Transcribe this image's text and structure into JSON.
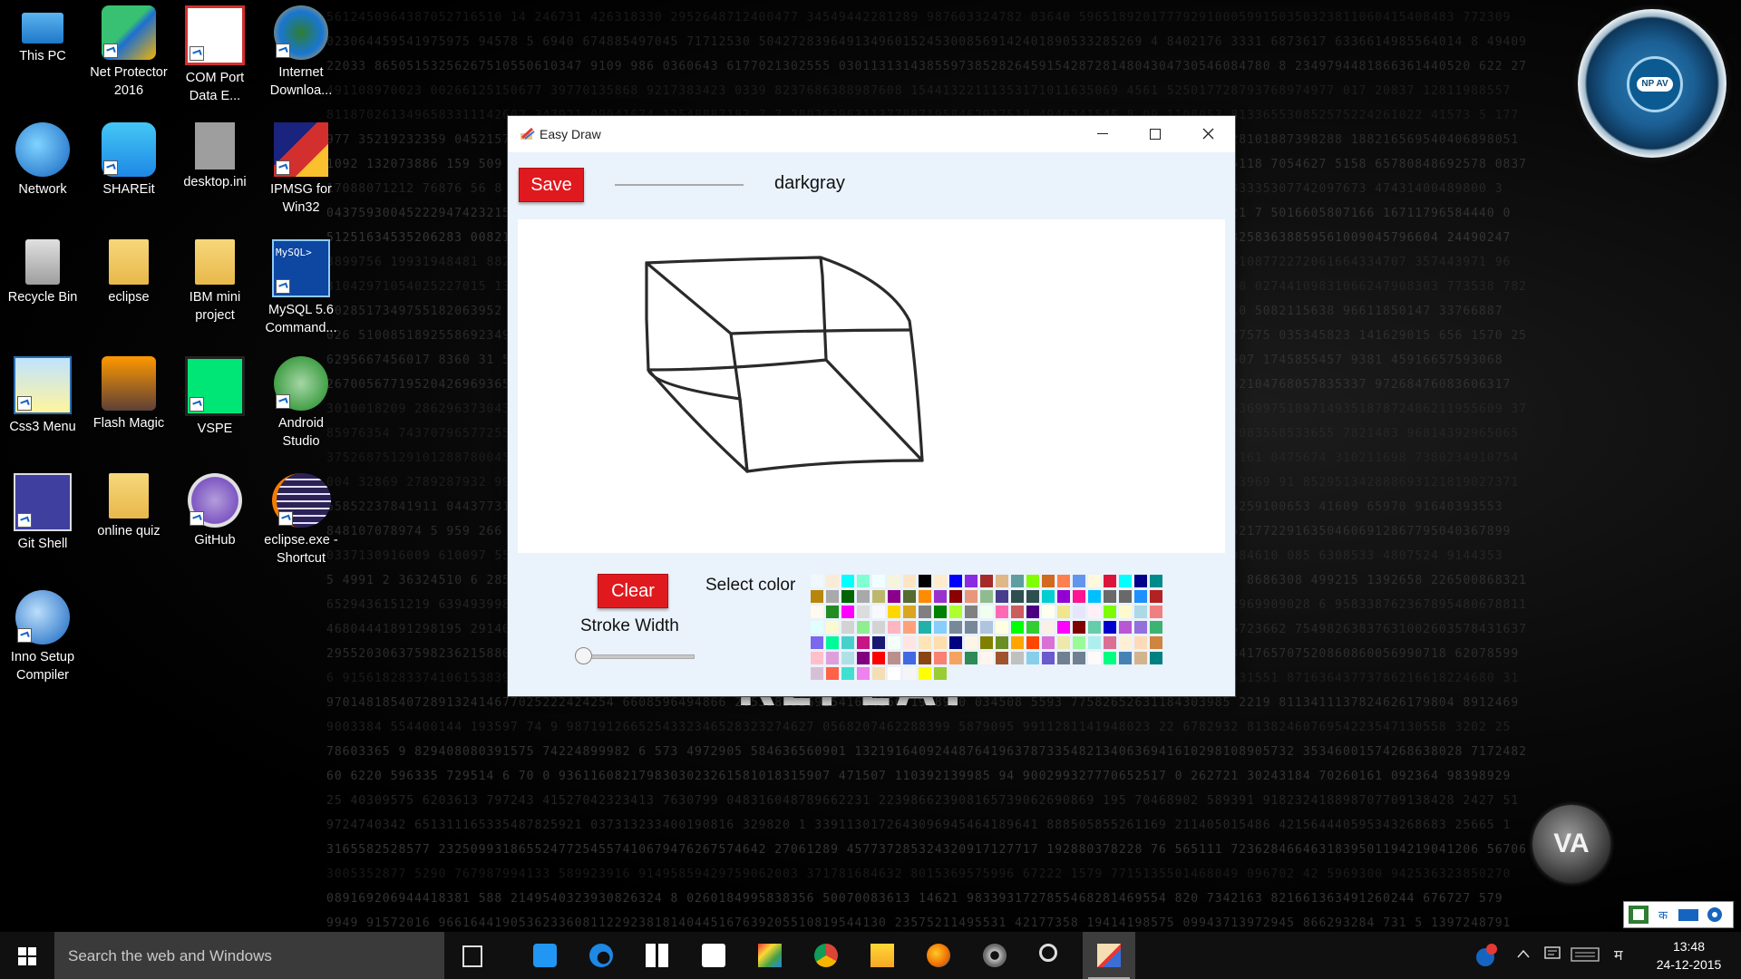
{
  "desktop": {
    "icons": [
      {
        "label": "This PC",
        "icon": "this-pc-icon"
      },
      {
        "label": "Net Protector 2016",
        "icon": "net-protector-icon"
      },
      {
        "label": "COM Port Data E...",
        "icon": "com-port-icon"
      },
      {
        "label": "Internet Downloa...",
        "icon": "internet-download-manager-icon"
      },
      {
        "label": "Network",
        "icon": "network-icon"
      },
      {
        "label": "SHAREit",
        "icon": "shareit-icon"
      },
      {
        "label": "desktop.ini",
        "icon": "ini-file-icon"
      },
      {
        "label": "IPMSG for Win32",
        "icon": "ipmsg-icon"
      },
      {
        "label": "Recycle Bin",
        "icon": "recycle-bin-icon"
      },
      {
        "label": "eclipse",
        "icon": "folder-icon"
      },
      {
        "label": "IBM mini project",
        "icon": "folder-icon"
      },
      {
        "label": "MySQL 5.6 Command...",
        "icon": "mysql-icon",
        "badge": "MySQL>"
      },
      {
        "label": "Css3 Menu",
        "icon": "css3-menu-icon"
      },
      {
        "label": "Flash Magic",
        "icon": "flash-magic-icon"
      },
      {
        "label": "VSPE",
        "icon": "vspe-icon"
      },
      {
        "label": "Android Studio",
        "icon": "android-studio-icon"
      },
      {
        "label": "Git Shell",
        "icon": "git-shell-icon"
      },
      {
        "label": "online quiz",
        "icon": "folder-icon"
      },
      {
        "label": "GitHub",
        "icon": "github-icon"
      },
      {
        "label": "eclipse.exe - Shortcut",
        "icon": "eclipse-icon"
      },
      {
        "label": "Inno Setup Compiler",
        "icon": "inno-setup-icon"
      }
    ],
    "widgets": {
      "npav_badge": "NP AV",
      "va_label": "VA"
    },
    "wallpaper_text": "REPEAT"
  },
  "window": {
    "title": "Easy Draw",
    "save_label": "Save",
    "color_name": "darkgray",
    "clear_label": "Clear",
    "select_color_label": "Select color",
    "stroke_width_label": "Stroke Width",
    "stroke_width_value": 0,
    "current_color": "#a9a9a9"
  },
  "palette": [
    "#f0f8ff",
    "#faebd7",
    "#00ffff",
    "#7fffd4",
    "#f0ffff",
    "#f5f5dc",
    "#ffe4c4",
    "#000000",
    "#ffebcd",
    "#0000ff",
    "#8a2be2",
    "#a52a2a",
    "#deb887",
    "#5f9ea0",
    "#7fff00",
    "#d2691e",
    "#ff7f50",
    "#6495ed",
    "#fff8dc",
    "#dc143c",
    "#00ffff",
    "#00008b",
    "#008b8b",
    "#b8860b",
    "#a9a9a9",
    "#006400",
    "#a9a9a9",
    "#bdb76b",
    "#8b008b",
    "#556b2f",
    "#ff8c00",
    "#9932cc",
    "#8b0000",
    "#e9967a",
    "#8fbc8f",
    "#483d8b",
    "#2f4f4f",
    "#2f4f4f",
    "#00ced1",
    "#9400d3",
    "#ff1493",
    "#00bfff",
    "#696969",
    "#696969",
    "#1e90ff",
    "#b22222",
    "#fffaf0",
    "#228b22",
    "#ff00ff",
    "#dcdcdc",
    "#f8f8ff",
    "#ffd700",
    "#daa520",
    "#808080",
    "#008000",
    "#adff2f",
    "#808080",
    "#f0fff0",
    "#ff69b4",
    "#cd5c5c",
    "#4b0082",
    "#fffff0",
    "#f0e68c",
    "#e6e6fa",
    "#fff0f5",
    "#7cfc00",
    "#fffacd",
    "#add8e6",
    "#f08080",
    "#e0ffff",
    "#fafad2",
    "#d3d3d3",
    "#90ee90",
    "#d3d3d3",
    "#ffb6c1",
    "#ffa07a",
    "#20b2aa",
    "#87cefa",
    "#778899",
    "#778899",
    "#b0c4de",
    "#ffffe0",
    "#00ff00",
    "#32cd32",
    "#faf0e6",
    "#ff00ff",
    "#800000",
    "#66cdaa",
    "#0000cd",
    "#ba55d3",
    "#9370db",
    "#3cb371",
    "#7b68ee",
    "#00fa9a",
    "#48d1cc",
    "#c71585",
    "#191970",
    "#f5fffa",
    "#ffe4e1",
    "#ffe4b5",
    "#ffdead",
    "#000080",
    "#fdf5e6",
    "#808000",
    "#6b8e23",
    "#ffa500",
    "#ff4500",
    "#da70d6",
    "#eee8aa",
    "#98fb98",
    "#afeeee",
    "#db7093",
    "#ffefd5",
    "#ffdab9",
    "#cd853f",
    "#ffc0cb",
    "#dda0dd",
    "#b0e0e6",
    "#800080",
    "#ff0000",
    "#bc8f8f",
    "#4169e1",
    "#8b4513",
    "#fa8072",
    "#f4a460",
    "#2e8b57",
    "#fff5ee",
    "#a0522d",
    "#c0c0c0",
    "#87ceeb",
    "#6a5acd",
    "#708090",
    "#708090",
    "#fffafa",
    "#00ff7f",
    "#4682b4",
    "#d2b48c",
    "#008080",
    "#d8bfd8",
    "#ff6347",
    "#40e0d0",
    "#ee82ee",
    "#f5deb3",
    "#ffffff",
    "#f5f5f5",
    "#ffff00",
    "#9acd32"
  ],
  "taskbar": {
    "search_placeholder": "Search the web and Windows",
    "apps": [
      {
        "name": "task-view-icon"
      },
      {
        "name": "touch-app-icon"
      },
      {
        "name": "edge-icon"
      },
      {
        "name": "store-icon"
      },
      {
        "name": "dropbox-icon"
      },
      {
        "name": "photo-app-icon"
      },
      {
        "name": "chrome-icon"
      },
      {
        "name": "file-explorer-icon"
      },
      {
        "name": "firefox-icon"
      },
      {
        "name": "settings-gear-icon"
      },
      {
        "name": "magnifier-icon"
      },
      {
        "name": "easy-draw-icon"
      }
    ],
    "time": "13:48",
    "date": "24-12-2015",
    "ime_char": "म"
  }
}
